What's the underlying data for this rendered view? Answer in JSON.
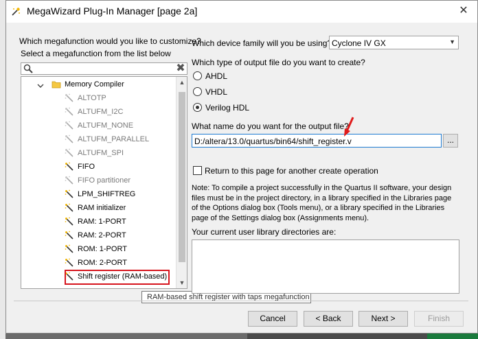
{
  "window": {
    "title": "MegaWizard Plug-In Manager [page 2a]",
    "close_glyph": "✕"
  },
  "left": {
    "question": "Which megafunction would you like to customize?",
    "select_label": "Select a megafunction from the list below",
    "clear_glyph": "✖",
    "tree": [
      {
        "label": "Memory Compiler",
        "type": "folder",
        "enabled": true
      },
      {
        "label": "ALTOTP",
        "type": "wand",
        "enabled": false
      },
      {
        "label": "ALTUFM_I2C",
        "type": "wand",
        "enabled": false
      },
      {
        "label": "ALTUFM_NONE",
        "type": "wand",
        "enabled": false
      },
      {
        "label": "ALTUFM_PARALLEL",
        "type": "wand",
        "enabled": false
      },
      {
        "label": "ALTUFM_SPI",
        "type": "wand",
        "enabled": false
      },
      {
        "label": "FIFO",
        "type": "wand",
        "enabled": true
      },
      {
        "label": "FIFO partitioner",
        "type": "wand",
        "enabled": false
      },
      {
        "label": "LPM_SHIFTREG",
        "type": "wand",
        "enabled": true
      },
      {
        "label": "RAM initializer",
        "type": "wand",
        "enabled": true
      },
      {
        "label": "RAM: 1-PORT",
        "type": "wand",
        "enabled": true
      },
      {
        "label": "RAM: 2-PORT",
        "type": "wand",
        "enabled": true
      },
      {
        "label": "ROM: 1-PORT",
        "type": "wand",
        "enabled": true
      },
      {
        "label": "ROM: 2-PORT",
        "type": "wand",
        "enabled": true
      },
      {
        "label": "Shift register (RAM-based)",
        "type": "wand",
        "enabled": true
      }
    ],
    "tooltip": "RAM-based shift register with taps megafunction"
  },
  "right": {
    "device_question": "Which device family will you be using?",
    "device_value": "Cyclone IV GX",
    "output_question": "Which type of output file do you want to create?",
    "radio_options": [
      "AHDL",
      "VHDL",
      "Verilog HDL"
    ],
    "selected_option": "Verilog HDL",
    "filename_question": "What name do you want for the output file?",
    "filename_value": "D:/altera/13.0/quartus/bin64/shift_register.v",
    "browse_label": "...",
    "return_label": "Return to this page for another create operation",
    "note": "Note: To compile a project successfully in the Quartus II software, your design files must be in the project directory, in a library specified in the Libraries page of the Options dialog box (Tools menu), or a library specified in the Libraries page of the Settings dialog box (Assignments menu).",
    "library_label": "Your current user library directories are:"
  },
  "buttons": {
    "cancel": "Cancel",
    "back": "< Back",
    "next": "Next >",
    "finish": "Finish"
  },
  "colors": {
    "highlight_border": "#d6141d",
    "input_focus": "#1f7bd1"
  }
}
